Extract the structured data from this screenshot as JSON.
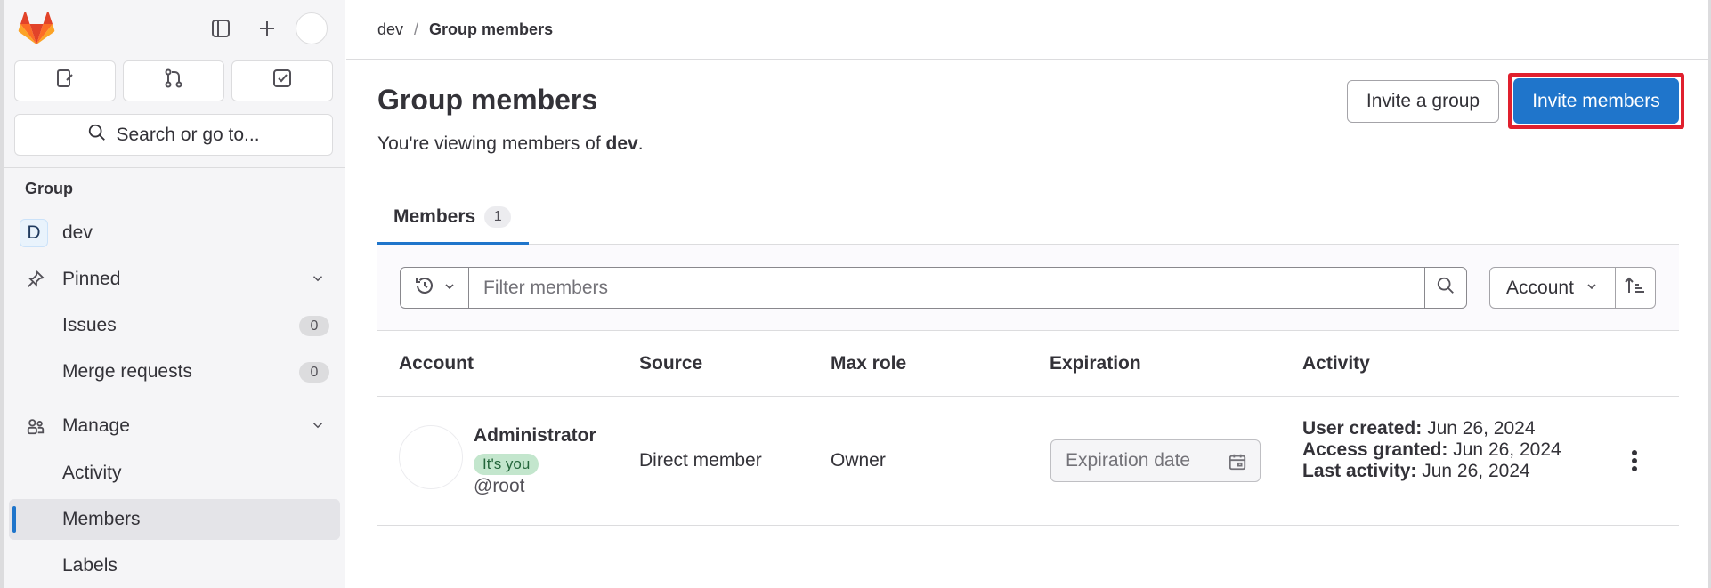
{
  "sidebar": {
    "search_label": "Search or go to...",
    "group_heading": "Group",
    "group_initial": "D",
    "group_name": "dev",
    "pinned_label": "Pinned",
    "issues_label": "Issues",
    "issues_count": "0",
    "mr_label": "Merge requests",
    "mr_count": "0",
    "manage_label": "Manage",
    "activity_label": "Activity",
    "members_label": "Members",
    "labels_label": "Labels"
  },
  "breadcrumb": {
    "root": "dev",
    "separator": "/",
    "current": "Group members"
  },
  "header": {
    "title": "Group members",
    "subtitle_prefix": "You're viewing members of ",
    "subtitle_group": "dev",
    "subtitle_suffix": ".",
    "invite_group": "Invite a group",
    "invite_members": "Invite members"
  },
  "tabs": {
    "members_label": "Members",
    "members_count": "1"
  },
  "filter": {
    "placeholder": "Filter members",
    "sort_label": "Account"
  },
  "table": {
    "columns": [
      "Account",
      "Source",
      "Max role",
      "Expiration",
      "Activity"
    ],
    "rows": [
      {
        "name": "Administrator",
        "badge": "It's you",
        "username": "@root",
        "source": "Direct member",
        "role": "Owner",
        "expiration_placeholder": "Expiration date",
        "user_created_label": "User created:",
        "user_created": "Jun 26, 2024",
        "access_granted_label": "Access granted:",
        "access_granted": "Jun 26, 2024",
        "last_activity_label": "Last activity:",
        "last_activity": "Jun 26, 2024"
      }
    ]
  },
  "colors": {
    "primary": "#1f75cb",
    "highlight": "#e0202e",
    "badge_bg": "#c3e6cd"
  }
}
